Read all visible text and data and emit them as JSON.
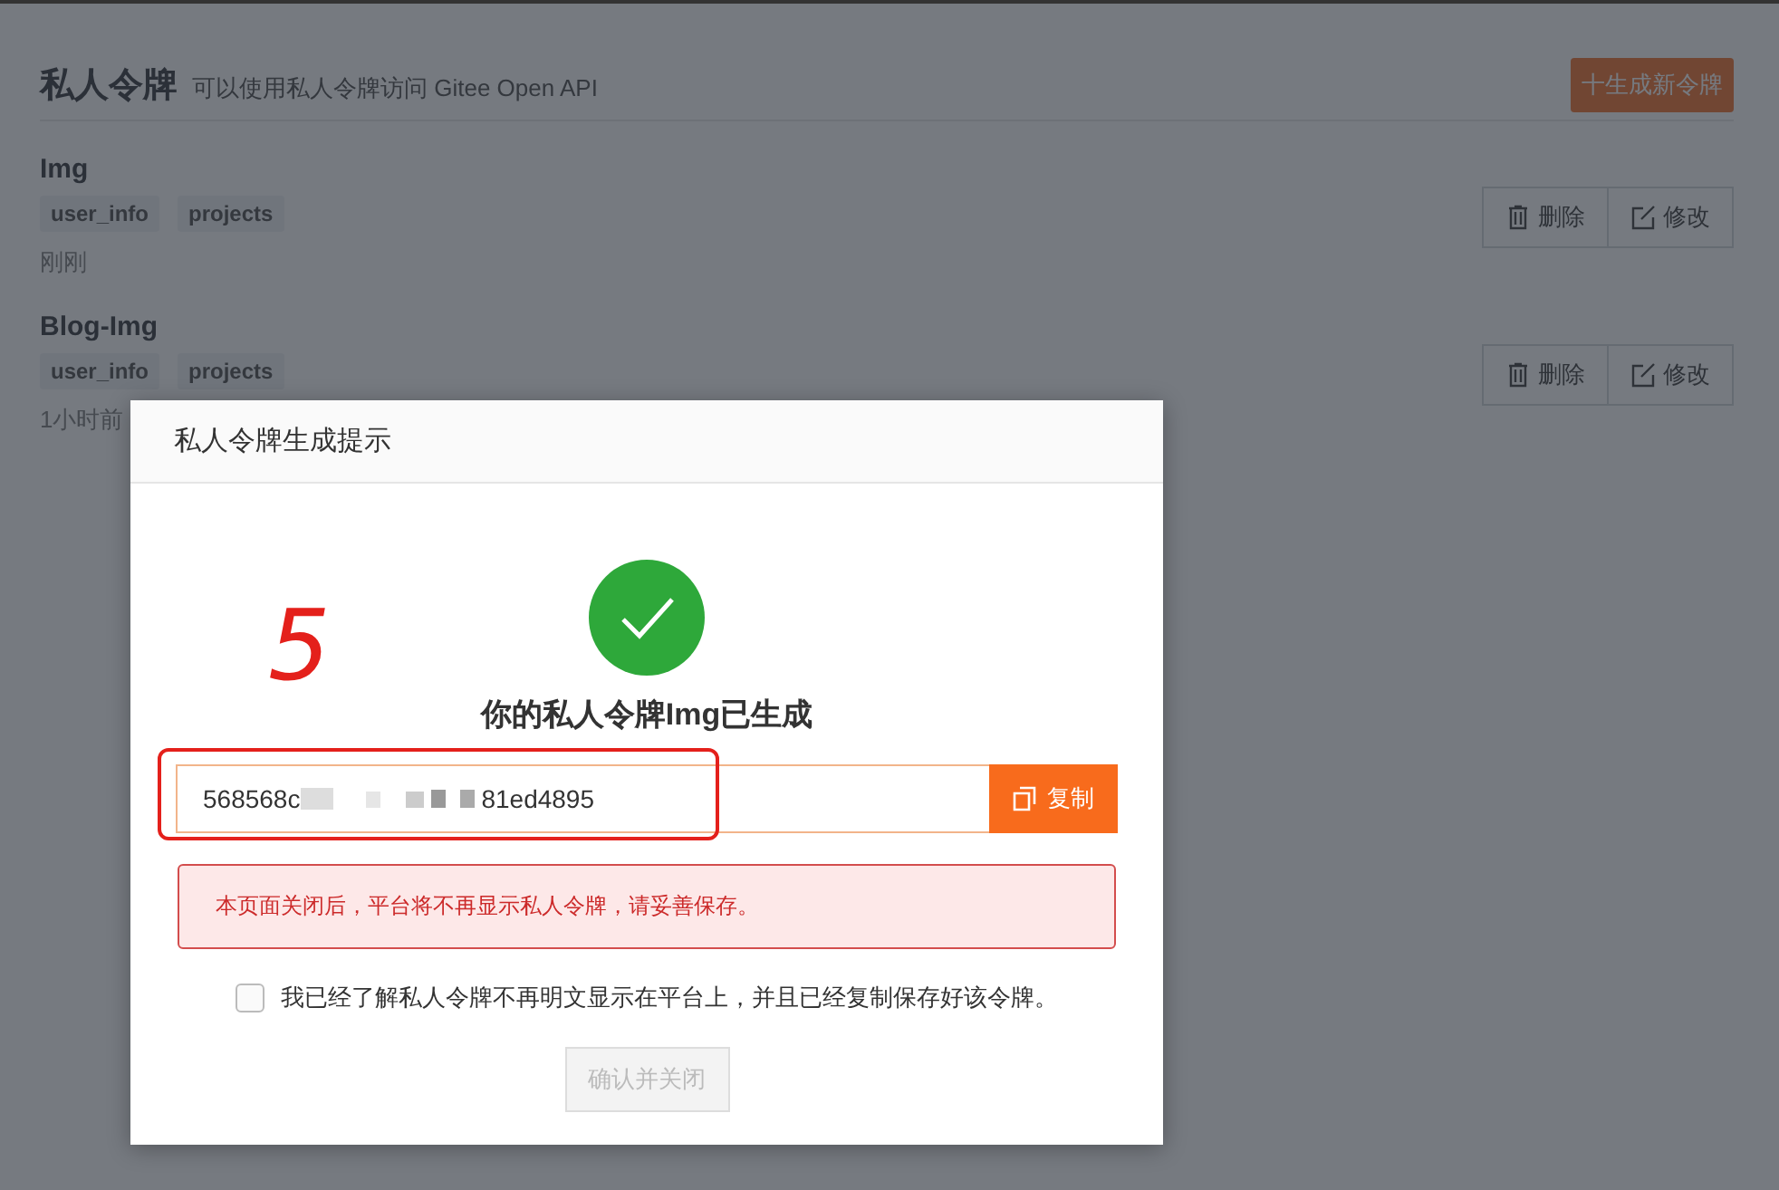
{
  "header": {
    "title": "私人令牌",
    "subtitle": "可以使用私人令牌访问 Gitee Open API",
    "new_button": "十生成新令牌"
  },
  "tokens": [
    {
      "name": "Img",
      "scopes": [
        "user_info",
        "projects"
      ],
      "time": "刚刚",
      "delete": "删除",
      "edit": "修改"
    },
    {
      "name": "Blog-Img",
      "scopes": [
        "user_info",
        "projects"
      ],
      "time": "1小时前",
      "delete": "删除",
      "edit": "修改"
    }
  ],
  "dialog": {
    "title": "私人令牌生成提示",
    "message": "你的私人令牌Img已生成",
    "token_start": "568568c",
    "token_end": "81ed4895",
    "copy": "复制",
    "warning": "本页面关闭后，平台将不再显示私人令牌，请妥善保存。",
    "confirm_label": "我已经了解私人令牌不再明文显示在平台上，并且已经复制保存好该令牌。",
    "checked": false,
    "close_button": "确认并关闭",
    "close_disabled": true
  },
  "annotation": {
    "mark": "5"
  }
}
